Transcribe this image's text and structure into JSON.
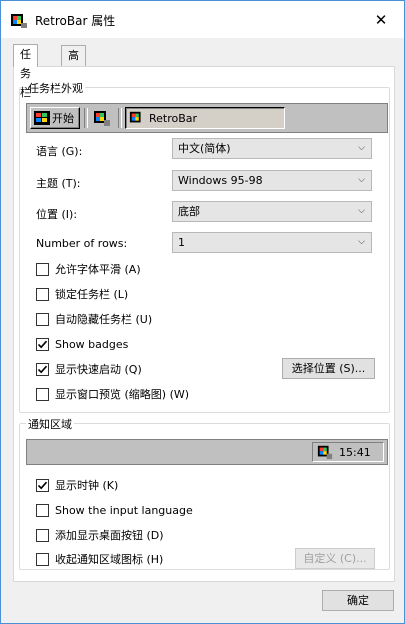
{
  "window": {
    "title": "RetroBar 属性",
    "close_glyph": "✕"
  },
  "tabs": [
    {
      "label": "任务栏",
      "active": true
    },
    {
      "label": "高级",
      "active": false
    }
  ],
  "taskbar_appearance": {
    "legend": "任务栏外观",
    "preview": {
      "start_label": "开始",
      "task_label": "RetroBar"
    },
    "fields": [
      {
        "label": "语言 (G):",
        "value": "中文(简体)"
      },
      {
        "label": "主题 (T):",
        "value": "Windows 95-98"
      },
      {
        "label": "位置 (I):",
        "value": "底部"
      },
      {
        "label": "Number of rows:",
        "value": "1"
      }
    ],
    "checkboxes": [
      {
        "label": "允许字体平滑 (A)",
        "checked": false
      },
      {
        "label": "锁定任务栏 (L)",
        "checked": false
      },
      {
        "label": "自动隐藏任务栏 (U)",
        "checked": false
      },
      {
        "label": "Show badges",
        "checked": true
      },
      {
        "label": "显示快速启动 (Q)",
        "checked": true
      },
      {
        "label": "显示窗口预览 (缩略图) (W)",
        "checked": false
      }
    ],
    "choose_location_button": "选择位置 (S)..."
  },
  "notification_area": {
    "legend": "通知区域",
    "clock": "15:41",
    "checkboxes": [
      {
        "label": "显示时钟 (K)",
        "checked": true
      },
      {
        "label": "Show the input language",
        "checked": false
      },
      {
        "label": "添加显示桌面按钮 (D)",
        "checked": false
      },
      {
        "label": "收起通知区域图标 (H)",
        "checked": false
      }
    ],
    "customize_button": "自定义 (C)..."
  },
  "footer": {
    "ok_button": "确定"
  },
  "icons": {
    "app": "retrobar-app-icon",
    "check": "checkmark-icon",
    "dropdown": "chevron-down-icon"
  }
}
